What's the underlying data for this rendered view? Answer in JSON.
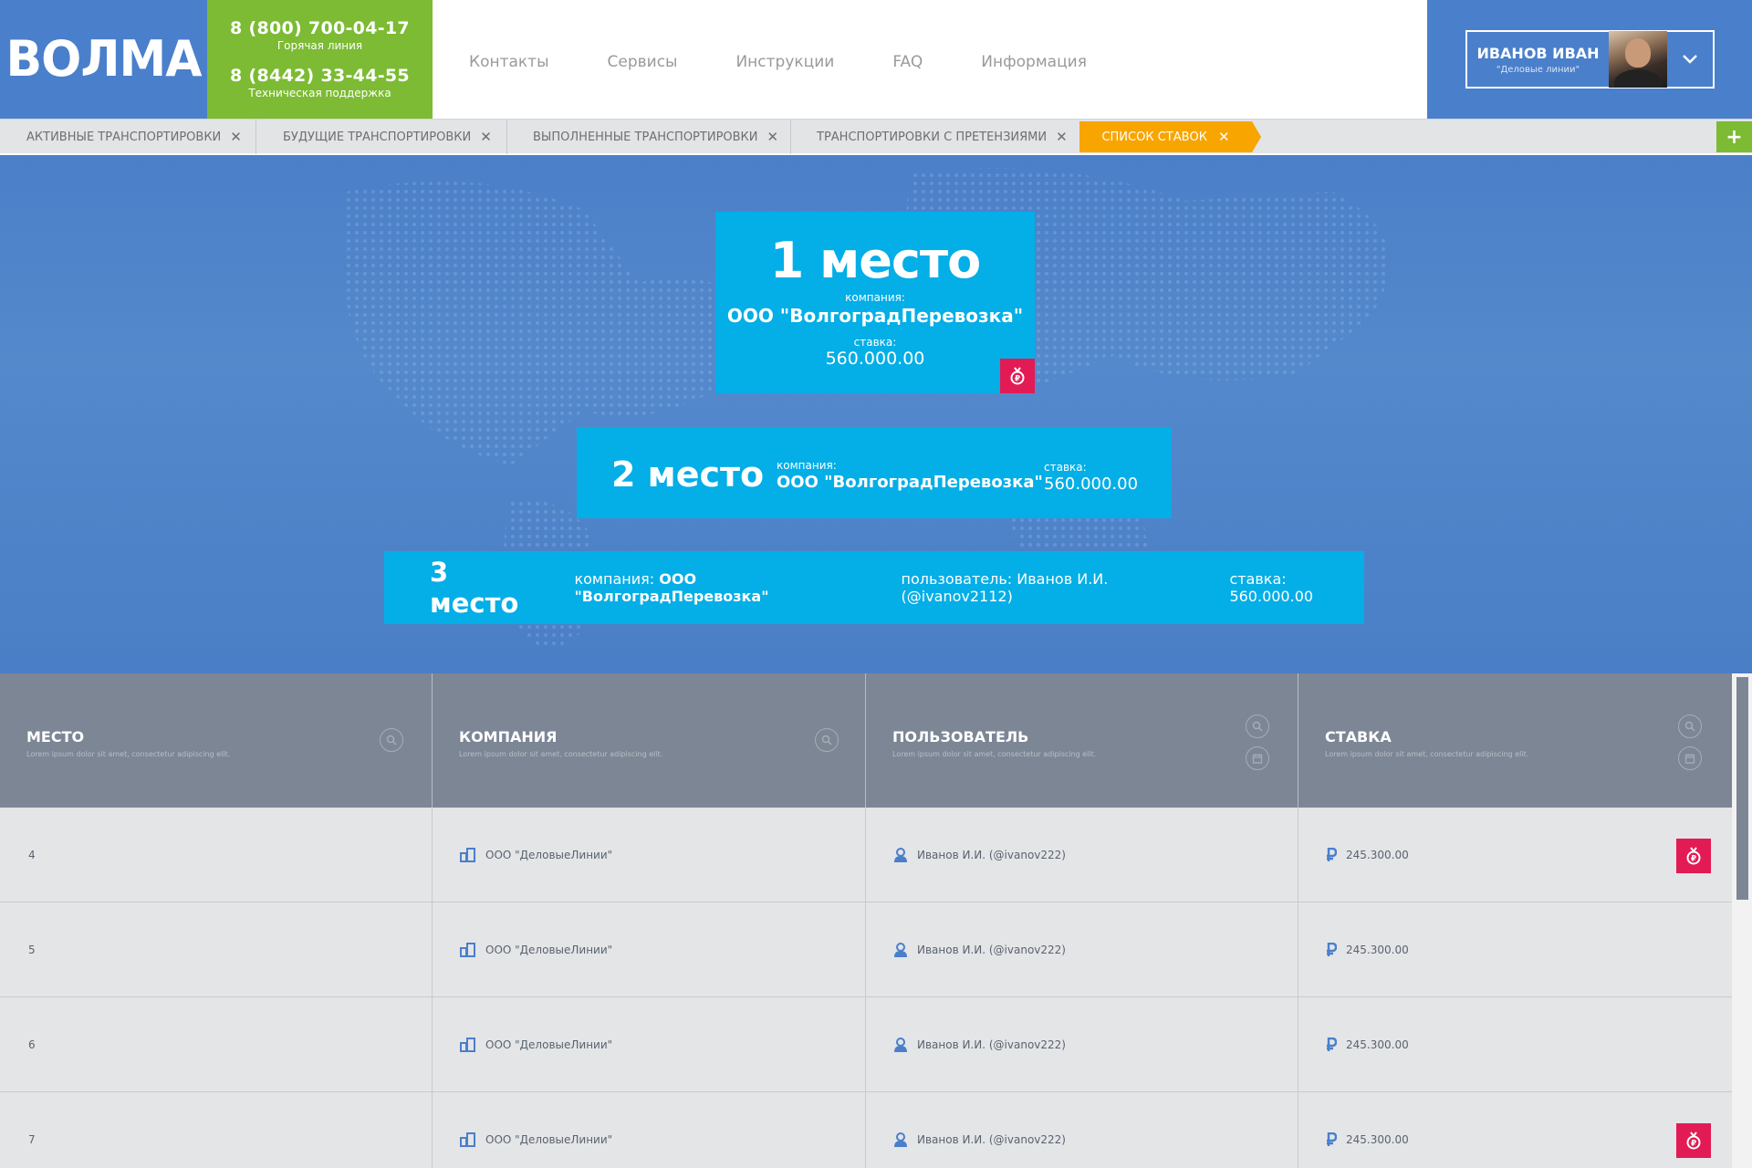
{
  "header": {
    "logo": "ВОЛМА",
    "hotline_phone": "8 (800) 700-04-17",
    "hotline_label": "Горячая линия",
    "support_phone": "8 (8442) 33-44-55",
    "support_label": "Техническая поддержка",
    "nav": [
      "Контакты",
      "Сервисы",
      "Инструкции",
      "FAQ",
      "Информация"
    ],
    "user_name": "ИВАНОВ ИВАН",
    "user_company": "\"Деловые линии\""
  },
  "tabs": {
    "items": [
      "АКТИВНЫЕ ТРАНСПОРТИРОВКИ",
      "БУДУЩИЕ ТРАНСПОРТИРОВКИ",
      "ВЫПОЛНЕННЫЕ ТРАНСПОРТИРОВКИ",
      "ТРАНСПОРТИРОВКИ С ПРЕТЕНЗИЯМИ"
    ],
    "active": "СПИСОК СТАВОК",
    "close_glyph": "✕",
    "add_glyph": "+"
  },
  "podium": {
    "first": {
      "place": "1 место",
      "company_label": "компания:",
      "company": "ООО \"ВолгоградПеревозка\"",
      "rate_label": "ставка:",
      "rate": "560.000.00"
    },
    "second": {
      "place": "2 место",
      "company_label": "компания:",
      "company": "ООО \"ВолгоградПеревозка\"",
      "rate_label": "ставка:",
      "rate": "560.000.00"
    },
    "third": {
      "place": "3 место",
      "company_label": "компания:",
      "company": "ООО \"ВолгоградПеревозка\"",
      "user_label": "пользователь:",
      "user": "Иванов И.И. (@ivanov2112)",
      "rate_label": "ставка:",
      "rate": "560.000.00"
    }
  },
  "table": {
    "columns": [
      {
        "title": "МЕСТО",
        "desc": "Lorem ipsum dolor sit amet,  consectetur adipiscing elit."
      },
      {
        "title": "КОМПАНИЯ",
        "desc": "Lorem ipsum dolor sit amet, consectetur adipiscing elit."
      },
      {
        "title": "ПОЛЬЗОВАТЕЛЬ",
        "desc": "Lorem ipsum dolor sit amet, consectetur adipiscing elit."
      },
      {
        "title": "СТАВКА",
        "desc": "Lorem ipsum dolor sit amet, consectetur adipiscing elit."
      }
    ],
    "rows": [
      {
        "place": "4",
        "company": "ООО \"ДеловыеЛинии\"",
        "user": "Иванов И.И. (@ivanov222)",
        "rate": "245.300.00",
        "medal": true
      },
      {
        "place": "5",
        "company": "ООО \"ДеловыеЛинии\"",
        "user": "Иванов И.И. (@ivanov222)",
        "rate": "245.300.00",
        "medal": false
      },
      {
        "place": "6",
        "company": "ООО \"ДеловыеЛинии\"",
        "user": "Иванов И.И. (@ivanov222)",
        "rate": "245.300.00",
        "medal": false
      },
      {
        "place": "7",
        "company": "ООО \"ДеловыеЛинии\"",
        "user": "Иванов И.И. (@ivanov222)",
        "rate": "245.300.00",
        "medal": true
      }
    ]
  },
  "colors": {
    "brand_blue": "#4a7fcb",
    "green": "#7cbb33",
    "orange": "#f8a500",
    "card_cyan": "#04aee7",
    "medal_red": "#e21b55",
    "table_head": "#7d8695"
  },
  "icons": [
    "search-icon",
    "calendar-icon",
    "building-icon",
    "user-icon",
    "ruble-icon",
    "medal-icon",
    "chevron-down-icon",
    "close-icon",
    "plus-icon"
  ]
}
